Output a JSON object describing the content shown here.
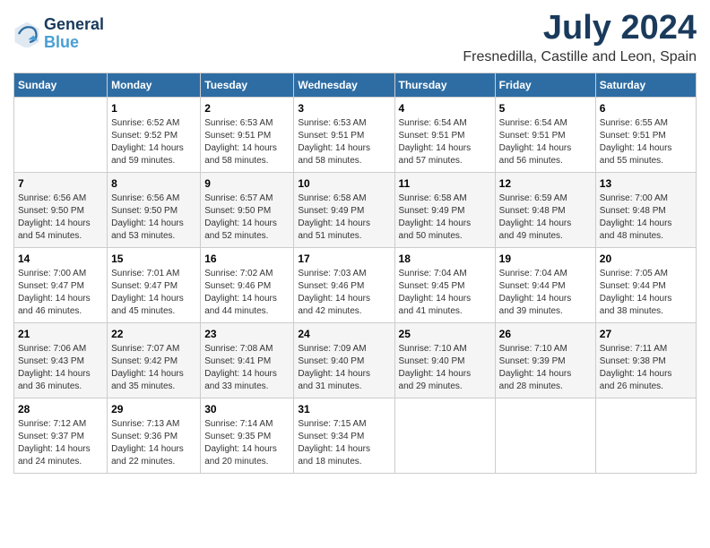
{
  "logo": {
    "line1": "General",
    "line2": "Blue"
  },
  "title": "July 2024",
  "subtitle": "Fresnedilla, Castille and Leon, Spain",
  "headers": [
    "Sunday",
    "Monday",
    "Tuesday",
    "Wednesday",
    "Thursday",
    "Friday",
    "Saturday"
  ],
  "weeks": [
    [
      {
        "day": "",
        "info": ""
      },
      {
        "day": "1",
        "info": "Sunrise: 6:52 AM\nSunset: 9:52 PM\nDaylight: 14 hours\nand 59 minutes."
      },
      {
        "day": "2",
        "info": "Sunrise: 6:53 AM\nSunset: 9:51 PM\nDaylight: 14 hours\nand 58 minutes."
      },
      {
        "day": "3",
        "info": "Sunrise: 6:53 AM\nSunset: 9:51 PM\nDaylight: 14 hours\nand 58 minutes."
      },
      {
        "day": "4",
        "info": "Sunrise: 6:54 AM\nSunset: 9:51 PM\nDaylight: 14 hours\nand 57 minutes."
      },
      {
        "day": "5",
        "info": "Sunrise: 6:54 AM\nSunset: 9:51 PM\nDaylight: 14 hours\nand 56 minutes."
      },
      {
        "day": "6",
        "info": "Sunrise: 6:55 AM\nSunset: 9:51 PM\nDaylight: 14 hours\nand 55 minutes."
      }
    ],
    [
      {
        "day": "7",
        "info": "Sunrise: 6:56 AM\nSunset: 9:50 PM\nDaylight: 14 hours\nand 54 minutes."
      },
      {
        "day": "8",
        "info": "Sunrise: 6:56 AM\nSunset: 9:50 PM\nDaylight: 14 hours\nand 53 minutes."
      },
      {
        "day": "9",
        "info": "Sunrise: 6:57 AM\nSunset: 9:50 PM\nDaylight: 14 hours\nand 52 minutes."
      },
      {
        "day": "10",
        "info": "Sunrise: 6:58 AM\nSunset: 9:49 PM\nDaylight: 14 hours\nand 51 minutes."
      },
      {
        "day": "11",
        "info": "Sunrise: 6:58 AM\nSunset: 9:49 PM\nDaylight: 14 hours\nand 50 minutes."
      },
      {
        "day": "12",
        "info": "Sunrise: 6:59 AM\nSunset: 9:48 PM\nDaylight: 14 hours\nand 49 minutes."
      },
      {
        "day": "13",
        "info": "Sunrise: 7:00 AM\nSunset: 9:48 PM\nDaylight: 14 hours\nand 48 minutes."
      }
    ],
    [
      {
        "day": "14",
        "info": "Sunrise: 7:00 AM\nSunset: 9:47 PM\nDaylight: 14 hours\nand 46 minutes."
      },
      {
        "day": "15",
        "info": "Sunrise: 7:01 AM\nSunset: 9:47 PM\nDaylight: 14 hours\nand 45 minutes."
      },
      {
        "day": "16",
        "info": "Sunrise: 7:02 AM\nSunset: 9:46 PM\nDaylight: 14 hours\nand 44 minutes."
      },
      {
        "day": "17",
        "info": "Sunrise: 7:03 AM\nSunset: 9:46 PM\nDaylight: 14 hours\nand 42 minutes."
      },
      {
        "day": "18",
        "info": "Sunrise: 7:04 AM\nSunset: 9:45 PM\nDaylight: 14 hours\nand 41 minutes."
      },
      {
        "day": "19",
        "info": "Sunrise: 7:04 AM\nSunset: 9:44 PM\nDaylight: 14 hours\nand 39 minutes."
      },
      {
        "day": "20",
        "info": "Sunrise: 7:05 AM\nSunset: 9:44 PM\nDaylight: 14 hours\nand 38 minutes."
      }
    ],
    [
      {
        "day": "21",
        "info": "Sunrise: 7:06 AM\nSunset: 9:43 PM\nDaylight: 14 hours\nand 36 minutes."
      },
      {
        "day": "22",
        "info": "Sunrise: 7:07 AM\nSunset: 9:42 PM\nDaylight: 14 hours\nand 35 minutes."
      },
      {
        "day": "23",
        "info": "Sunrise: 7:08 AM\nSunset: 9:41 PM\nDaylight: 14 hours\nand 33 minutes."
      },
      {
        "day": "24",
        "info": "Sunrise: 7:09 AM\nSunset: 9:40 PM\nDaylight: 14 hours\nand 31 minutes."
      },
      {
        "day": "25",
        "info": "Sunrise: 7:10 AM\nSunset: 9:40 PM\nDaylight: 14 hours\nand 29 minutes."
      },
      {
        "day": "26",
        "info": "Sunrise: 7:10 AM\nSunset: 9:39 PM\nDaylight: 14 hours\nand 28 minutes."
      },
      {
        "day": "27",
        "info": "Sunrise: 7:11 AM\nSunset: 9:38 PM\nDaylight: 14 hours\nand 26 minutes."
      }
    ],
    [
      {
        "day": "28",
        "info": "Sunrise: 7:12 AM\nSunset: 9:37 PM\nDaylight: 14 hours\nand 24 minutes."
      },
      {
        "day": "29",
        "info": "Sunrise: 7:13 AM\nSunset: 9:36 PM\nDaylight: 14 hours\nand 22 minutes."
      },
      {
        "day": "30",
        "info": "Sunrise: 7:14 AM\nSunset: 9:35 PM\nDaylight: 14 hours\nand 20 minutes."
      },
      {
        "day": "31",
        "info": "Sunrise: 7:15 AM\nSunset: 9:34 PM\nDaylight: 14 hours\nand 18 minutes."
      },
      {
        "day": "",
        "info": ""
      },
      {
        "day": "",
        "info": ""
      },
      {
        "day": "",
        "info": ""
      }
    ]
  ]
}
